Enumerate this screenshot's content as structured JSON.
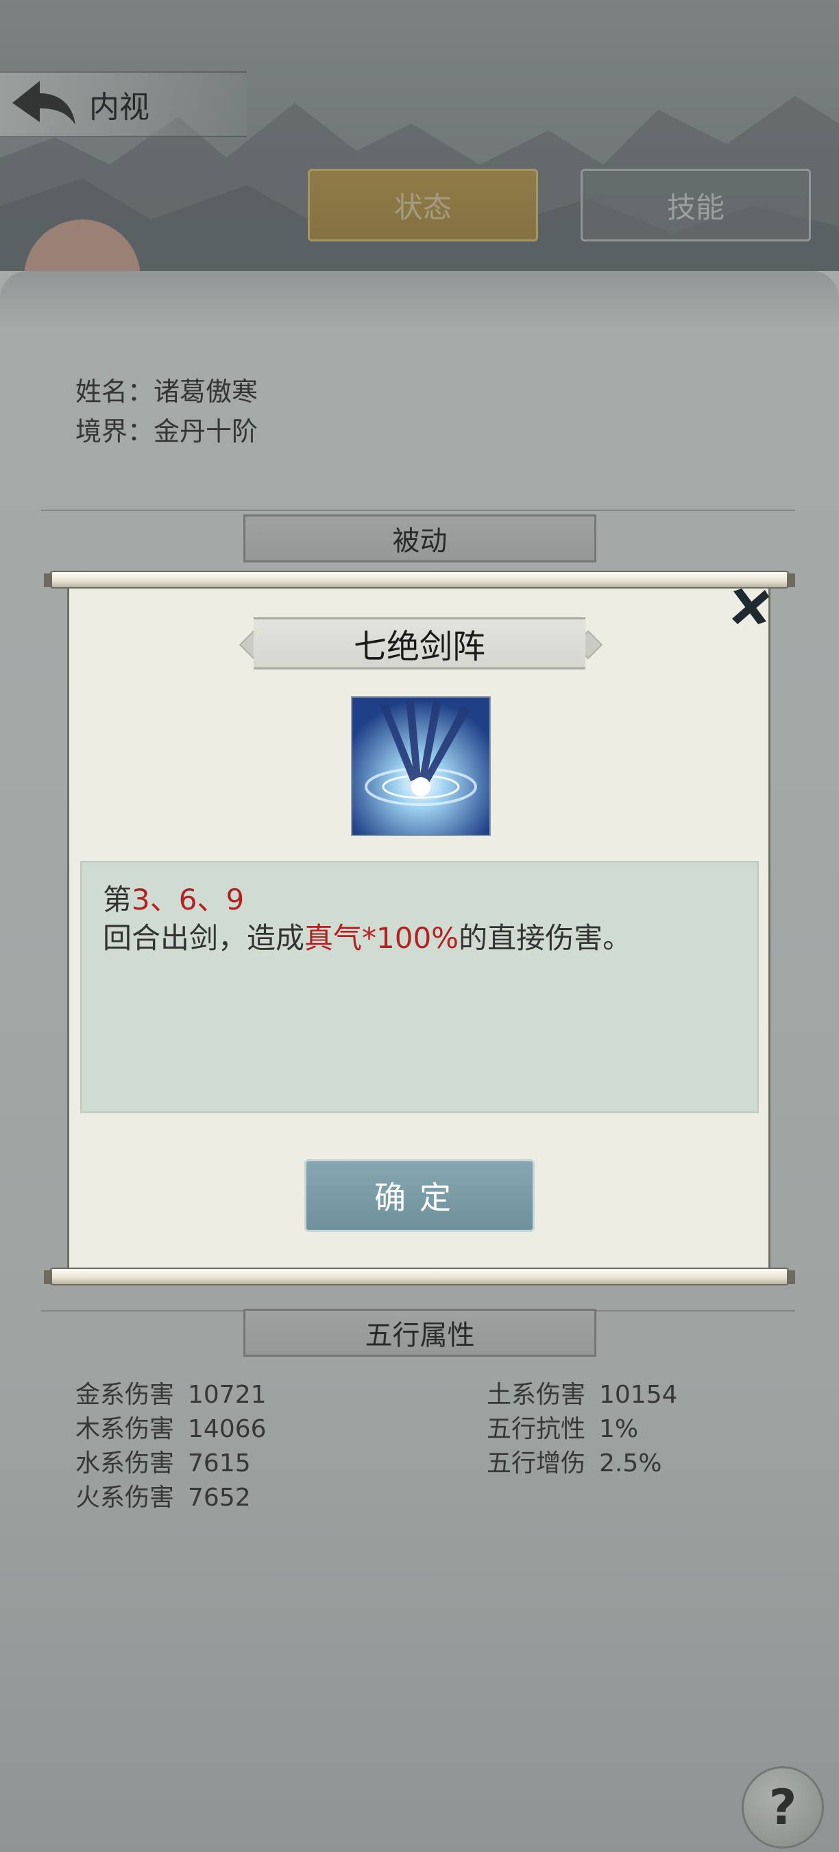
{
  "header": {
    "title": "内视",
    "back_icon": "back-arrow-icon"
  },
  "tabs": [
    {
      "label": "状态",
      "active": true
    },
    {
      "label": "技能",
      "active": false
    }
  ],
  "character": {
    "name": "姓名：诸葛傲寒",
    "realm": "境界：金丹十阶"
  },
  "sections": {
    "passive": "被动",
    "five_elements": "五行属性"
  },
  "five_elements_stats": {
    "left": [
      {
        "label": "金系伤害",
        "value": "10721"
      },
      {
        "label": "木系伤害",
        "value": "14066"
      },
      {
        "label": "水系伤害",
        "value": "7615"
      },
      {
        "label": "火系伤害",
        "value": "7652"
      }
    ],
    "right": [
      {
        "label": "土系伤害",
        "value": "10154"
      },
      {
        "label": "五行抗性",
        "value": "1%"
      },
      {
        "label": "五行增伤",
        "value": "2.5%"
      }
    ]
  },
  "dialog": {
    "skill_name": "七绝剑阵",
    "desc_line1_prefix": "第",
    "desc_line1_highlight": "3、6、9",
    "desc_line2_prefix": "回合出剑，造成",
    "desc_line2_highlight": "真气*100%",
    "desc_line2_suffix": "的直接伤害。",
    "confirm_label": "确定",
    "icons": {
      "close": "close-icon",
      "skill": "sword-formation-skill-icon"
    }
  },
  "help": {
    "label": "?"
  },
  "colors": {
    "highlight": "#b22222",
    "tab_active": "#b89648",
    "confirm_button": "#7b9ca7"
  }
}
